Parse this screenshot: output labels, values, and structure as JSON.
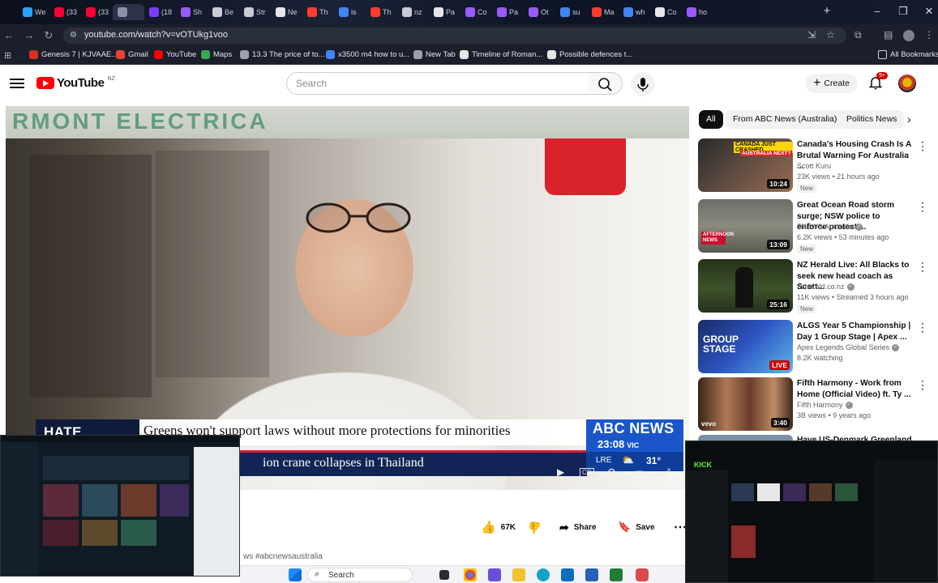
{
  "browser": {
    "tabs": [
      {
        "label": "We",
        "color": "#2aa0ff"
      },
      {
        "label": "(33",
        "color": "#ff0033"
      },
      {
        "label": "(33",
        "color": "#ff0033"
      },
      {
        "label": "",
        "color": "#8c93a8"
      },
      {
        "label": "(18",
        "color": "#7a3cff"
      },
      {
        "label": "Sh",
        "color": "#9b59ff"
      },
      {
        "label": "Be",
        "color": "#c9ccd6"
      },
      {
        "label": "Str",
        "color": "#c9ccd6"
      },
      {
        "label": "Ne",
        "color": "#e6e6e6"
      },
      {
        "label": "Th",
        "color": "#ff3b30"
      },
      {
        "label": "is",
        "color": "#4285f4"
      },
      {
        "label": "Th",
        "color": "#ff3b30"
      },
      {
        "label": "nz",
        "color": "#c9ccd6"
      },
      {
        "label": "Pa",
        "color": "#e6e6e6"
      },
      {
        "label": "Co",
        "color": "#9b59ff"
      },
      {
        "label": "Pa",
        "color": "#9b59ff"
      },
      {
        "label": "Ot",
        "color": "#9b59ff"
      },
      {
        "label": "su",
        "color": "#4285f4"
      },
      {
        "label": "Ma",
        "color": "#ff3b30"
      },
      {
        "label": "wh",
        "color": "#4285f4"
      },
      {
        "label": "Co",
        "color": "#e6e6e6"
      },
      {
        "label": "ho",
        "color": "#9b59ff"
      }
    ],
    "new_tab": "+",
    "url": "youtube.com/watch?v=vOTUkg1voo",
    "bookmarks": [
      {
        "label": "Genesis 7 | KJVAAE...",
        "color": "#d93025"
      },
      {
        "label": "Gmail",
        "color": "#ea4335"
      },
      {
        "label": "YouTube",
        "color": "#ff0000"
      },
      {
        "label": "Maps",
        "color": "#34a853"
      },
      {
        "label": "13.3 The price of to...",
        "color": "#9aa0ad"
      },
      {
        "label": "x3500 m4 how to u...",
        "color": "#4285f4"
      },
      {
        "label": "New Tab",
        "color": "#9aa0ad"
      },
      {
        "label": "Timeline of Roman...",
        "color": "#e6e6e6"
      },
      {
        "label": "Possible defences t...",
        "color": "#e6e6e6"
      }
    ],
    "all_bookmarks": "All Bookmarks"
  },
  "youtube": {
    "logo_text": "YouTube",
    "country": "NZ",
    "search_placeholder": "Search",
    "create_label": "Create",
    "notification_count": "9+"
  },
  "video": {
    "sign_text": "RMONT ELECTRICA",
    "lower_third_tag": "HATE SPEECH",
    "headline": "Greens won't support laws without more protections for minorities",
    "ticker": "ion crane collapses in Thailand",
    "network": "ABC NEWS",
    "time": "23:08",
    "timezone": "VIC",
    "weather_place": "LRE",
    "temperature": "31°"
  },
  "actions": {
    "likes": "67K",
    "share": "Share",
    "save": "Save"
  },
  "description_peek": "ws #abcnewsaustralia",
  "chips": [
    "All",
    "From ABC News (Australia)",
    "Politics News"
  ],
  "recommendations": [
    {
      "title": "Canada's Housing Crash Is A Brutal Warning For Australia ...",
      "channel": "Scott Kuru",
      "meta": "23K views • 21 hours ago",
      "badge": "New",
      "duration": "10:24",
      "verified": false
    },
    {
      "title": "Great Ocean Road storm surge; NSW police to enforce protest ...",
      "channel": "7NEWS Australia",
      "meta": "6.2K views • 53 minutes ago",
      "badge": "New",
      "duration": "13:09",
      "verified": true
    },
    {
      "title": "NZ Herald Live: All Blacks to seek new head coach as Scott...",
      "channel": "nzherald.co.nz",
      "meta": "11K views • Streamed 3 hours ago",
      "badge": "New",
      "duration": "25:16",
      "verified": true
    },
    {
      "title": "ALGS Year 5 Championship | Day 1 Group Stage | Apex ...",
      "channel": "Apex Legends Global Series",
      "meta": "8.2K watching",
      "badge": "",
      "duration": "LIVE",
      "verified": true
    },
    {
      "title": "Fifth Harmony - Work from Home (Official Video) ft. Ty ...",
      "channel": "Fifth Harmony",
      "meta": "3B views • 9 years ago",
      "badge": "",
      "duration": "3:40",
      "verified": true
    },
    {
      "title": "Have US-Denmark Greenland",
      "channel": "",
      "meta": "",
      "badge": "",
      "duration": "",
      "verified": false
    }
  ],
  "thumb_text": {
    "rec0": "CANADA JUST CRASHED",
    "rec0b": "AUSTRALIA NEXT?",
    "rec1": "AFTERNOON NEWS",
    "rec3": "GROUP STAGE",
    "rec4": "vevo"
  },
  "kick_brand": "KICK",
  "taskbar": {
    "search": "Search"
  }
}
